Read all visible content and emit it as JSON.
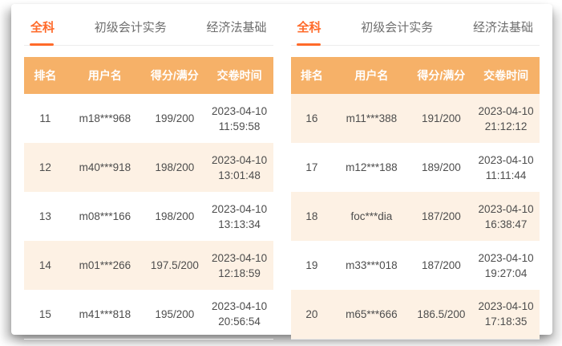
{
  "card": {
    "tabs": [
      {
        "label": "全科",
        "active": true
      },
      {
        "label": "初级会计实务",
        "active": false
      },
      {
        "label": "经济法基础",
        "active": false
      }
    ],
    "columns": {
      "rank": "排名",
      "user": "用户名",
      "score": "得分/满分",
      "time": "交卷时间"
    },
    "panels": [
      {
        "rows": [
          {
            "rank": "11",
            "user": "m18***968",
            "score": "199/200",
            "date": "2023-04-10",
            "time": "11:59:58"
          },
          {
            "rank": "12",
            "user": "m40***918",
            "score": "198/200",
            "date": "2023-04-10",
            "time": "13:01:48"
          },
          {
            "rank": "13",
            "user": "m08***166",
            "score": "198/200",
            "date": "2023-04-10",
            "time": "13:13:34"
          },
          {
            "rank": "14",
            "user": "m01***266",
            "score": "197.5/200",
            "date": "2023-04-10",
            "time": "12:18:59"
          },
          {
            "rank": "15",
            "user": "m41***818",
            "score": "195/200",
            "date": "2023-04-10",
            "time": "20:56:54"
          }
        ]
      },
      {
        "rows": [
          {
            "rank": "16",
            "user": "m11***388",
            "score": "191/200",
            "date": "2023-04-10",
            "time": "21:12:12"
          },
          {
            "rank": "17",
            "user": "m12***188",
            "score": "189/200",
            "date": "2023-04-10",
            "time": "11:11:44"
          },
          {
            "rank": "18",
            "user": "foc***dia",
            "score": "187/200",
            "date": "2023-04-10",
            "time": "16:38:47"
          },
          {
            "rank": "19",
            "user": "m33***018",
            "score": "187/200",
            "date": "2023-04-10",
            "time": "19:27:04"
          },
          {
            "rank": "20",
            "user": "m65***666",
            "score": "186.5/200",
            "date": "2023-04-10",
            "time": "17:18:35"
          }
        ]
      }
    ],
    "colors": {
      "accent": "#ff6a2a",
      "header_bg": "#f6b168",
      "row_shaded_bg": "#fdf1e4",
      "tab_inactive_text": "#6e6e6e",
      "cell_text": "#4d4d4d"
    }
  }
}
